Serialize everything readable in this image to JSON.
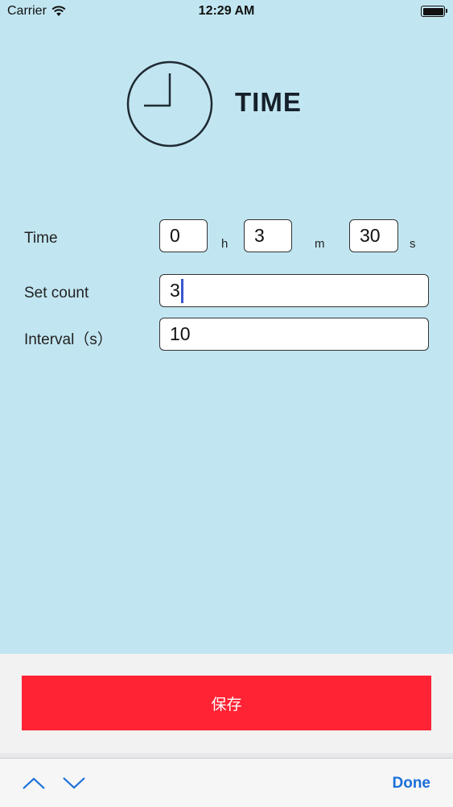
{
  "status_bar": {
    "carrier": "Carrier",
    "time": "12:29 AM"
  },
  "header": {
    "title": "TIME",
    "icon": "clock-icon"
  },
  "form": {
    "time_label": "Time",
    "hours_value": "0",
    "hours_unit": "h",
    "minutes_value": "3",
    "minutes_unit": "m",
    "seconds_value": "30",
    "seconds_unit": "s",
    "set_count_label": "Set count",
    "set_count_value": "3",
    "interval_label": "Interval（s）",
    "interval_value": "10"
  },
  "save_button": {
    "label": "保存"
  },
  "keyboard_toolbar": {
    "prev_icon": "chevron-up-icon",
    "next_icon": "chevron-down-icon",
    "done_label": "Done"
  },
  "colors": {
    "background": "#c2e6f1",
    "save_button": "#ff2334",
    "done_text": "#1a6fd8",
    "caret": "#3a56d0"
  }
}
